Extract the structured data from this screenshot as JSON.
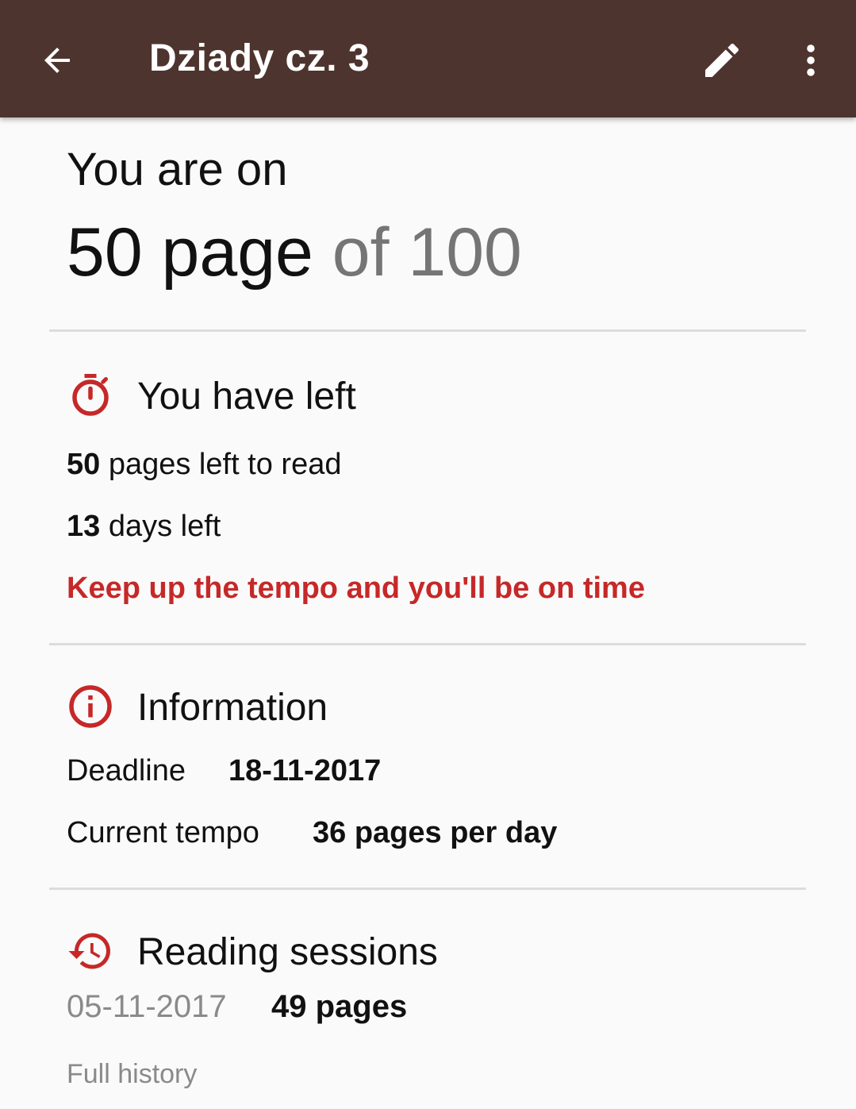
{
  "appbar": {
    "title": "Dziady cz. 3",
    "back_icon": "arrow-back-icon",
    "edit_icon": "pencil-icon",
    "more_icon": "more-vert-icon",
    "background": "#4e342e"
  },
  "progress": {
    "prefix": "You are on",
    "current": "50 page",
    "of_total": "of 100",
    "current_page": 50,
    "total_pages": 100
  },
  "left": {
    "icon": "stopwatch-icon",
    "title": "You have left",
    "pages_value": "50",
    "pages_text": " pages left to read",
    "days_value": "13",
    "days_text": " days left",
    "warning": "Keep up the tempo and you'll be on time"
  },
  "info": {
    "icon": "info-icon",
    "title": "Information",
    "deadline_label": "Deadline",
    "deadline_value": "18-11-2017",
    "tempo_label": "Current tempo",
    "tempo_value": "36 pages per day"
  },
  "sessions": {
    "icon": "history-icon",
    "title": "Reading sessions",
    "items": [
      {
        "date": "05-11-2017",
        "pages": "49 pages"
      }
    ],
    "full_history": "Full history"
  },
  "colors": {
    "accent": "#c62828",
    "muted": "#757575",
    "divider": "#dcdcdc"
  }
}
